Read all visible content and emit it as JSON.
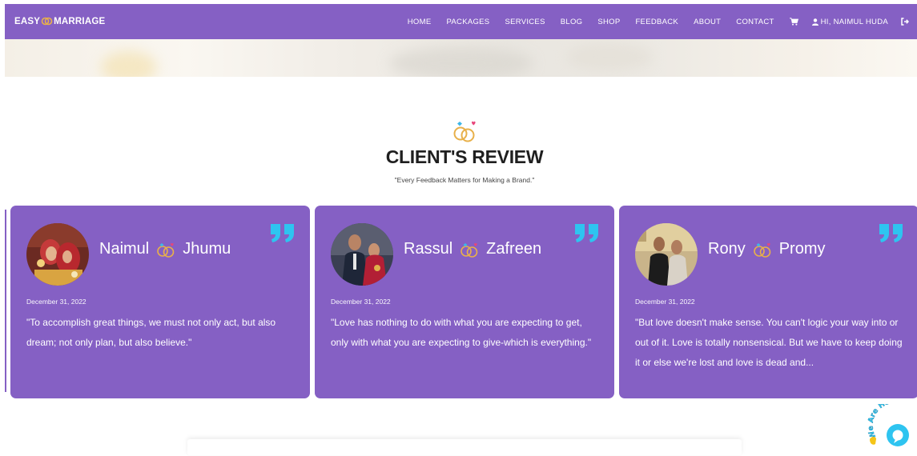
{
  "brand": {
    "left": "EASY",
    "right": "MARRIAGE"
  },
  "nav": {
    "links": [
      "HOME",
      "PACKAGES",
      "SERVICES",
      "BLOG",
      "SHOP",
      "FEEDBACK",
      "ABOUT",
      "CONTACT"
    ],
    "user_label": "HI, NAIMUL HUDA"
  },
  "section": {
    "title": "CLIENT'S REVIEW",
    "subtitle": "\"Every Feedback Matters for Making a Brand.\""
  },
  "reviews": [
    {
      "name1": "Naimul",
      "name2": "Jhumu",
      "date": "December 31, 2022",
      "text": "\"To accomplish great things, we must not only act, but also dream; not only plan, but also believe.\""
    },
    {
      "name1": "Rassul",
      "name2": "Zafreen",
      "date": "December 31, 2022",
      "text": "\"Love has nothing to do with what you are expecting to get, only with what you are expecting to give-which is everything.\""
    },
    {
      "name1": "Rony",
      "name2": "Promy",
      "date": "December 31, 2022",
      "text": "\"But love doesn't make sense. You can't logic your way into or out of it. Love is totally nonsensical. But we have to keep doing it or else we're lost and love is dead and..."
    }
  ],
  "chat_widget": {
    "label": "We Are Here"
  },
  "colors": {
    "primary": "#8560c4",
    "quote_accent": "#2ec4f0",
    "ring_gold": "#e8b04a",
    "ring_blue": "#3fb7e8",
    "ring_pink": "#e8457a"
  },
  "icons": [
    "cart-icon",
    "user-icon",
    "logout-icon",
    "rings-icon",
    "quote-icon",
    "chat-icon"
  ]
}
